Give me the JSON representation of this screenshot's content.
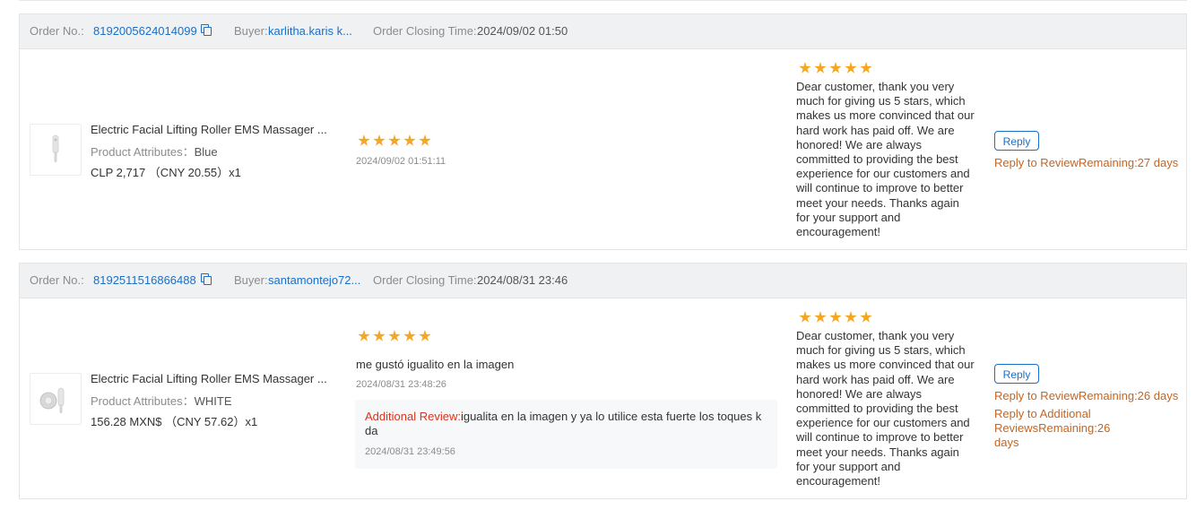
{
  "header_labels": {
    "order_no": "Order No.:",
    "buyer": "Buyer:",
    "closing": "Order Closing Time:",
    "product_attributes": "Product Attributes："
  },
  "reply_label": "Reply",
  "colors": {
    "link": "#1a6fc9",
    "star": "#f5a623",
    "remaining": "#c8641e",
    "additional_label": "#d9341f",
    "header_bg": "#f0f1f3"
  },
  "orders": [
    {
      "order_no": "8192005624014099",
      "buyer": "karlitha.karis k...",
      "closing_time": "2024/09/02 01:50",
      "product_name": "Electric Facial Lifting Roller EMS Massager ...",
      "attribute": "Blue",
      "price": "CLP 2,717 （CNY  20.55）x1",
      "rating": 5,
      "review_text": "",
      "review_time": "2024/09/02 01:51:11",
      "reply_rating": 5,
      "reply_text": "Dear customer, thank you very much for giving us 5 stars, which makes us more convinced that our hard work has paid off. We are honored! We are always committed to providing the best experience for our customers and will continue to improve to better meet your needs. Thanks again for your support and encouragement!",
      "remaining": "Reply to ReviewRemaining:27 days"
    },
    {
      "order_no": "8192511516866488",
      "buyer": "santamontejo72...",
      "closing_time": "2024/08/31 23:46",
      "product_name": "Electric Facial Lifting Roller EMS Massager ...",
      "attribute": "WHITE",
      "price": "156.28 MXN$ （CNY  57.62）x1",
      "rating": 5,
      "review_text": "me gustó igualito en la imagen",
      "review_time": "2024/08/31 23:48:26",
      "additional_label": "Additional Review:",
      "additional_text": "igualita en la imagen y ya lo utilice esta fuerte los toques k da",
      "additional_time": "2024/08/31 23:49:56",
      "reply_rating": 5,
      "reply_text": "Dear customer, thank you very much for giving us 5 stars, which makes us more convinced that our hard work has paid off. We are honored! We are always committed to providing the best experience for our customers and will continue to improve to better meet your needs. Thanks again for your support and encouragement!",
      "remaining": "Reply to ReviewRemaining:26 days",
      "remaining_additional": "Reply to Additional ReviewsRemaining:26 days"
    }
  ]
}
